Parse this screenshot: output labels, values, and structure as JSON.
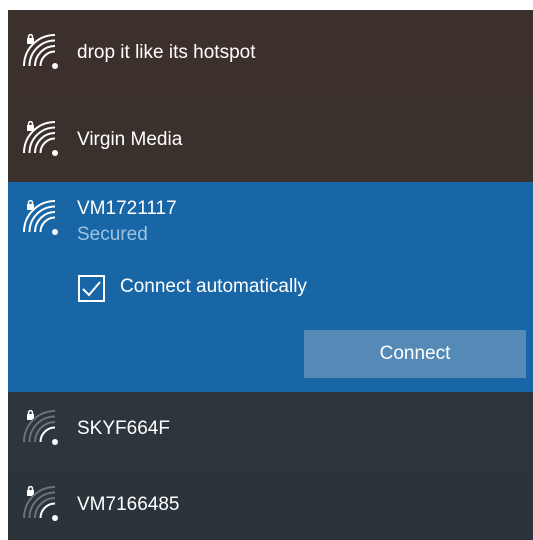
{
  "networks": [
    {
      "ssid": "drop it like its hotspot",
      "icon": "wifi-secured-full-icon"
    },
    {
      "ssid": "Virgin Media",
      "icon": "wifi-secured-full-icon"
    },
    {
      "ssid": "VM1721117",
      "icon": "wifi-secured-full-icon",
      "status": "Secured",
      "connect_automatically": {
        "label": "Connect automatically",
        "checked": true
      },
      "connect_button": "Connect"
    },
    {
      "ssid": "SKYF664F",
      "icon": "wifi-secured-weak-icon"
    },
    {
      "ssid": "VM7166485",
      "icon": "wifi-secured-weak-icon"
    }
  ],
  "colors": {
    "selected_background": "#1866a6",
    "button_background": "#5589b6",
    "secondary_text": "#9ec3e2",
    "top_background": "#3b302b",
    "bottom_background": "#2d363d"
  }
}
